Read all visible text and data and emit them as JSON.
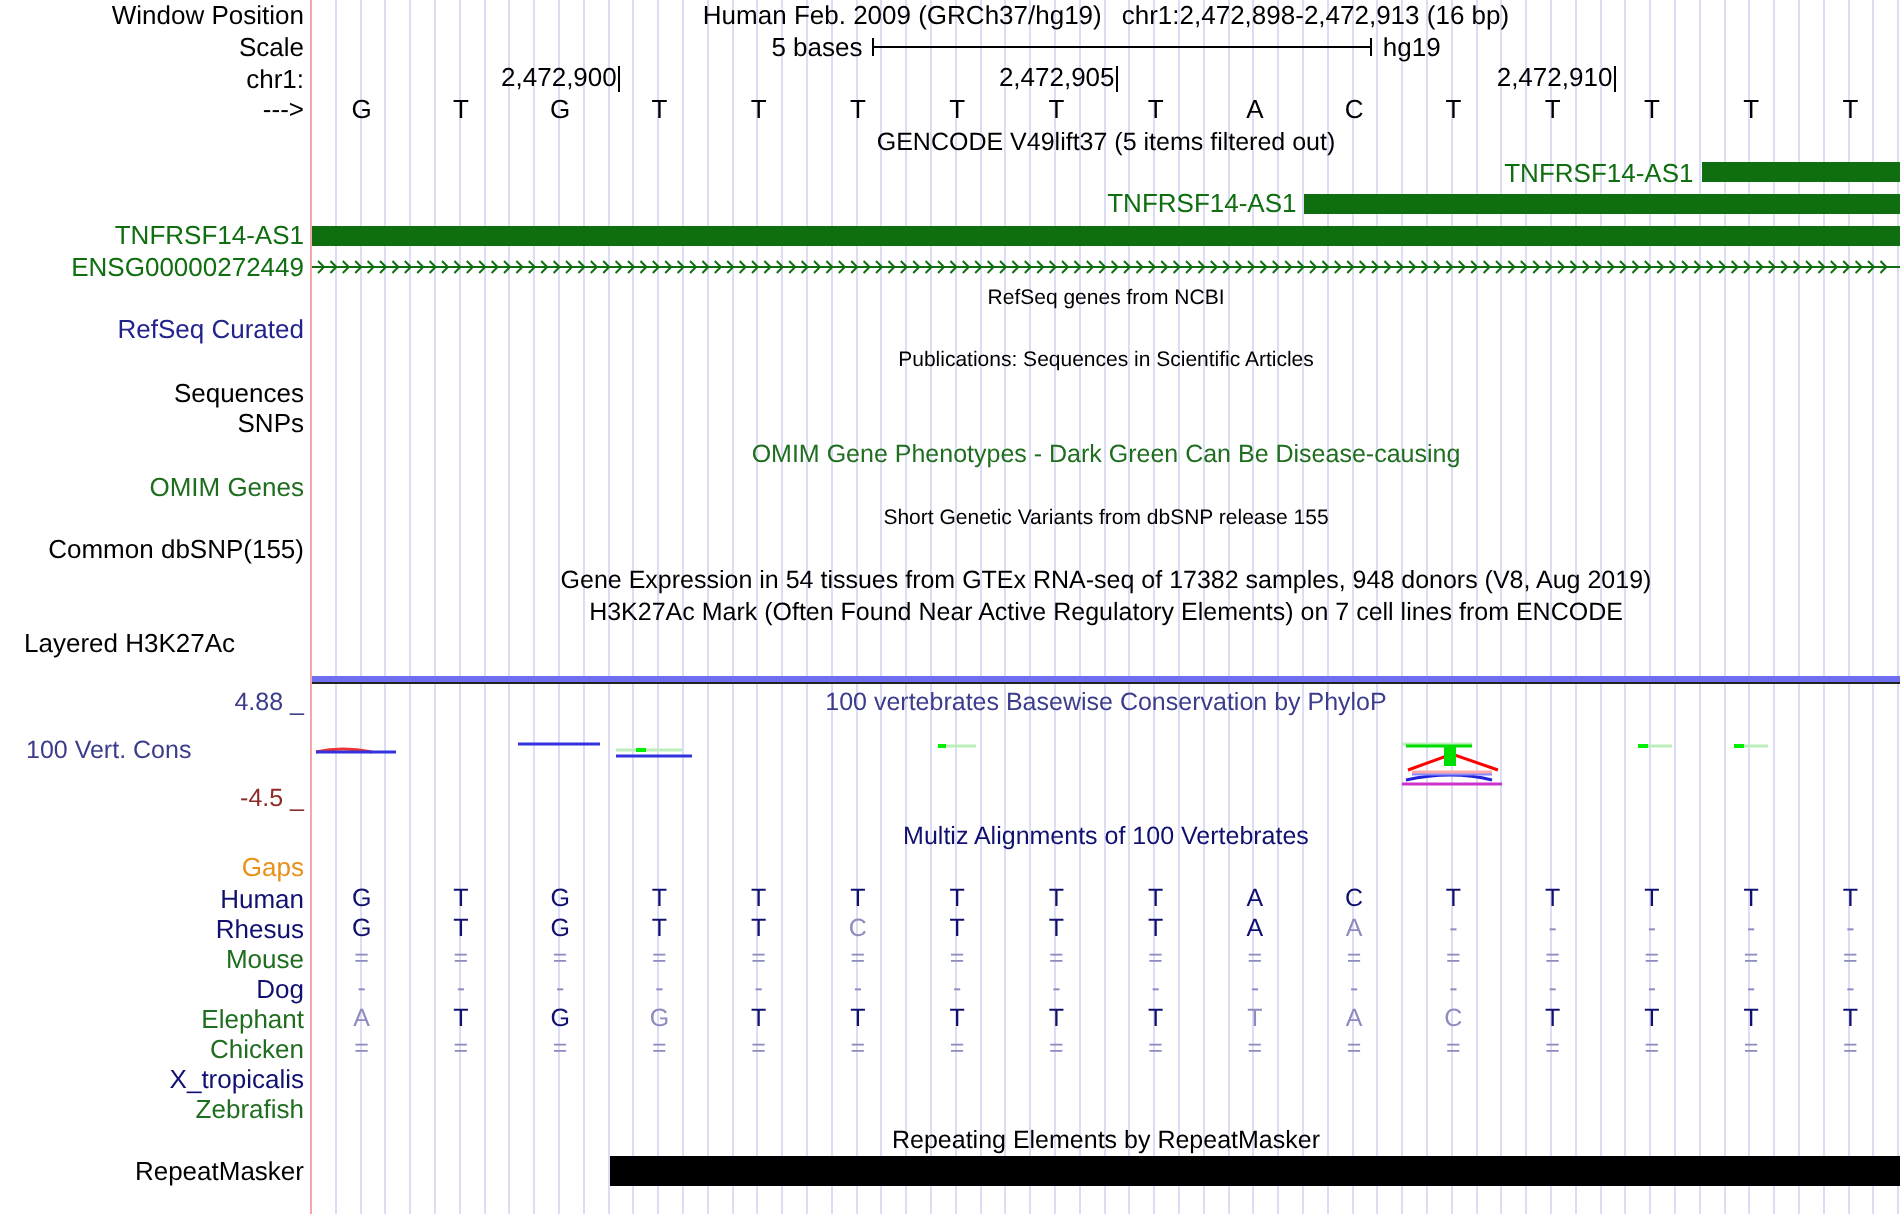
{
  "position_header": {
    "label": "Window Position",
    "assembly": "Human Feb. 2009 (GRCh37/hg19)",
    "range": "chr1:2,472,898-2,472,913 (16 bp)"
  },
  "scale": {
    "label": "Scale",
    "span": "5 bases",
    "assembly": "hg19"
  },
  "ruler": {
    "label": "chr1:",
    "ticks": [
      "2,472,900",
      "2,472,905",
      "2,472,910"
    ]
  },
  "sequence": {
    "label": "--->",
    "bases": [
      "G",
      "T",
      "G",
      "T",
      "T",
      "T",
      "T",
      "T",
      "T",
      "A",
      "C",
      "T",
      "T",
      "T",
      "T",
      "T"
    ]
  },
  "rows": [
    {
      "kind": "title",
      "text": "GENCODE V49lift37 (5 items filtered out)",
      "color": "#000000"
    },
    {
      "kind": "gene_inline",
      "name": "TNFRSF14-AS1",
      "color": "#0f6e0f"
    },
    {
      "kind": "gene_inline",
      "name": "TNFRSF14-AS1",
      "color": "#0f6e0f"
    },
    {
      "kind": "gene",
      "name": "TNFRSF14-AS1",
      "color": "#0f6e0f"
    },
    {
      "kind": "gene_line",
      "name": "ENSG00000272449",
      "color": "#0f6e0f"
    },
    {
      "kind": "caption",
      "text": "RefSeq genes from NCBI",
      "color": "#000000"
    },
    {
      "kind": "label",
      "label": "RefSeq Curated",
      "color": "#23238c"
    },
    {
      "kind": "caption",
      "text": "Publications: Sequences in Scientific Articles",
      "color": "#000000"
    },
    {
      "kind": "label",
      "label": "Sequences",
      "color": "#000000"
    },
    {
      "kind": "label",
      "label": "SNPs",
      "color": "#000000"
    },
    {
      "kind": "title",
      "text": "OMIM Gene Phenotypes - Dark Green Can Be Disease-causing",
      "color": "#1f6e1f"
    },
    {
      "kind": "label",
      "label": "OMIM Genes",
      "color": "#1f6e1f"
    },
    {
      "kind": "caption",
      "text": "Short Genetic Variants from dbSNP release 155",
      "color": "#000000"
    },
    {
      "kind": "label",
      "label": "Common dbSNP(155)",
      "color": "#000000"
    },
    {
      "kind": "title",
      "text": "Gene Expression in 54 tissues from GTEx RNA-seq of 17382 samples, 948 donors (V8, Aug 2019)",
      "color": "#000000"
    },
    {
      "kind": "title",
      "text": "H3K27Ac Mark (Often Found Near Active Regulatory Elements) on 7 cell lines from ENCODE",
      "color": "#000000"
    },
    {
      "kind": "label_left",
      "label": "Layered H3K27Ac",
      "color": "#000000"
    },
    {
      "kind": "divider"
    },
    {
      "kind": "conservation",
      "title": "100 vertebrates Basewise Conservation by PhyloP",
      "label": "100 Vert. Cons",
      "max": "4.88 _",
      "min": "-4.5 _",
      "color": "#3c3c8c"
    },
    {
      "kind": "title",
      "text": "Multiz Alignments of 100 Vertebrates",
      "color": "#101070"
    },
    {
      "kind": "label",
      "label": "Gaps",
      "color": "#e8901a"
    },
    {
      "kind": "alignment",
      "label": "Human",
      "color": "#101070",
      "bases": [
        "G",
        "T",
        "G",
        "T",
        "T",
        "T",
        "T",
        "T",
        "T",
        "A",
        "C",
        "T",
        "T",
        "T",
        "T",
        "T"
      ],
      "mismatch": [
        false,
        false,
        false,
        false,
        false,
        false,
        false,
        false,
        false,
        false,
        false,
        false,
        false,
        false,
        false,
        false
      ]
    },
    {
      "kind": "alignment",
      "label": "Rhesus",
      "color": "#101070",
      "bases": [
        "G",
        "T",
        "G",
        "T",
        "T",
        "C",
        "T",
        "T",
        "T",
        "A",
        "A",
        "-",
        "-",
        "-",
        "-",
        "-"
      ],
      "mismatch": [
        false,
        false,
        false,
        false,
        false,
        true,
        false,
        false,
        false,
        false,
        true,
        true,
        true,
        true,
        true,
        true
      ]
    },
    {
      "kind": "alignment",
      "label": "Mouse",
      "color": "#1f6e1f",
      "bases": [
        "=",
        "=",
        "=",
        "=",
        "=",
        "=",
        "=",
        "=",
        "=",
        "=",
        "=",
        "=",
        "=",
        "=",
        "=",
        "="
      ],
      "mismatch": [
        true,
        true,
        true,
        true,
        true,
        true,
        true,
        true,
        true,
        true,
        true,
        true,
        true,
        true,
        true,
        true
      ]
    },
    {
      "kind": "alignment",
      "label": "Dog",
      "color": "#101070",
      "bases": [
        "-",
        "-",
        "-",
        "-",
        "-",
        "-",
        "-",
        "-",
        "-",
        "-",
        "-",
        "-",
        "-",
        "-",
        "-",
        "-"
      ],
      "mismatch": [
        true,
        true,
        true,
        true,
        true,
        true,
        true,
        true,
        true,
        true,
        true,
        true,
        true,
        true,
        true,
        true
      ]
    },
    {
      "kind": "alignment",
      "label": "Elephant",
      "color": "#1f6e1f",
      "bases": [
        "A",
        "T",
        "G",
        "G",
        "T",
        "T",
        "T",
        "T",
        "T",
        "T",
        "A",
        "C",
        "T",
        "T",
        "T",
        "T"
      ],
      "mismatch": [
        true,
        false,
        false,
        true,
        false,
        false,
        false,
        false,
        false,
        true,
        true,
        true,
        false,
        false,
        false,
        false
      ]
    },
    {
      "kind": "alignment",
      "label": "Chicken",
      "color": "#1f6e1f",
      "bases": [
        "=",
        "=",
        "=",
        "=",
        "=",
        "=",
        "=",
        "=",
        "=",
        "=",
        "=",
        "=",
        "=",
        "=",
        "=",
        "="
      ],
      "mismatch": [
        true,
        true,
        true,
        true,
        true,
        true,
        true,
        true,
        true,
        true,
        true,
        true,
        true,
        true,
        true,
        true
      ]
    },
    {
      "kind": "alignment",
      "label": "X_tropicalis",
      "color": "#101070",
      "bases": [],
      "mismatch": []
    },
    {
      "kind": "alignment",
      "label": "Zebrafish",
      "color": "#1f6e1f",
      "bases": [],
      "mismatch": []
    },
    {
      "kind": "title",
      "text": "Repeating Elements by RepeatMasker",
      "color": "#000000"
    },
    {
      "kind": "repeat",
      "label": "RepeatMasker",
      "color": "#000000"
    }
  ]
}
